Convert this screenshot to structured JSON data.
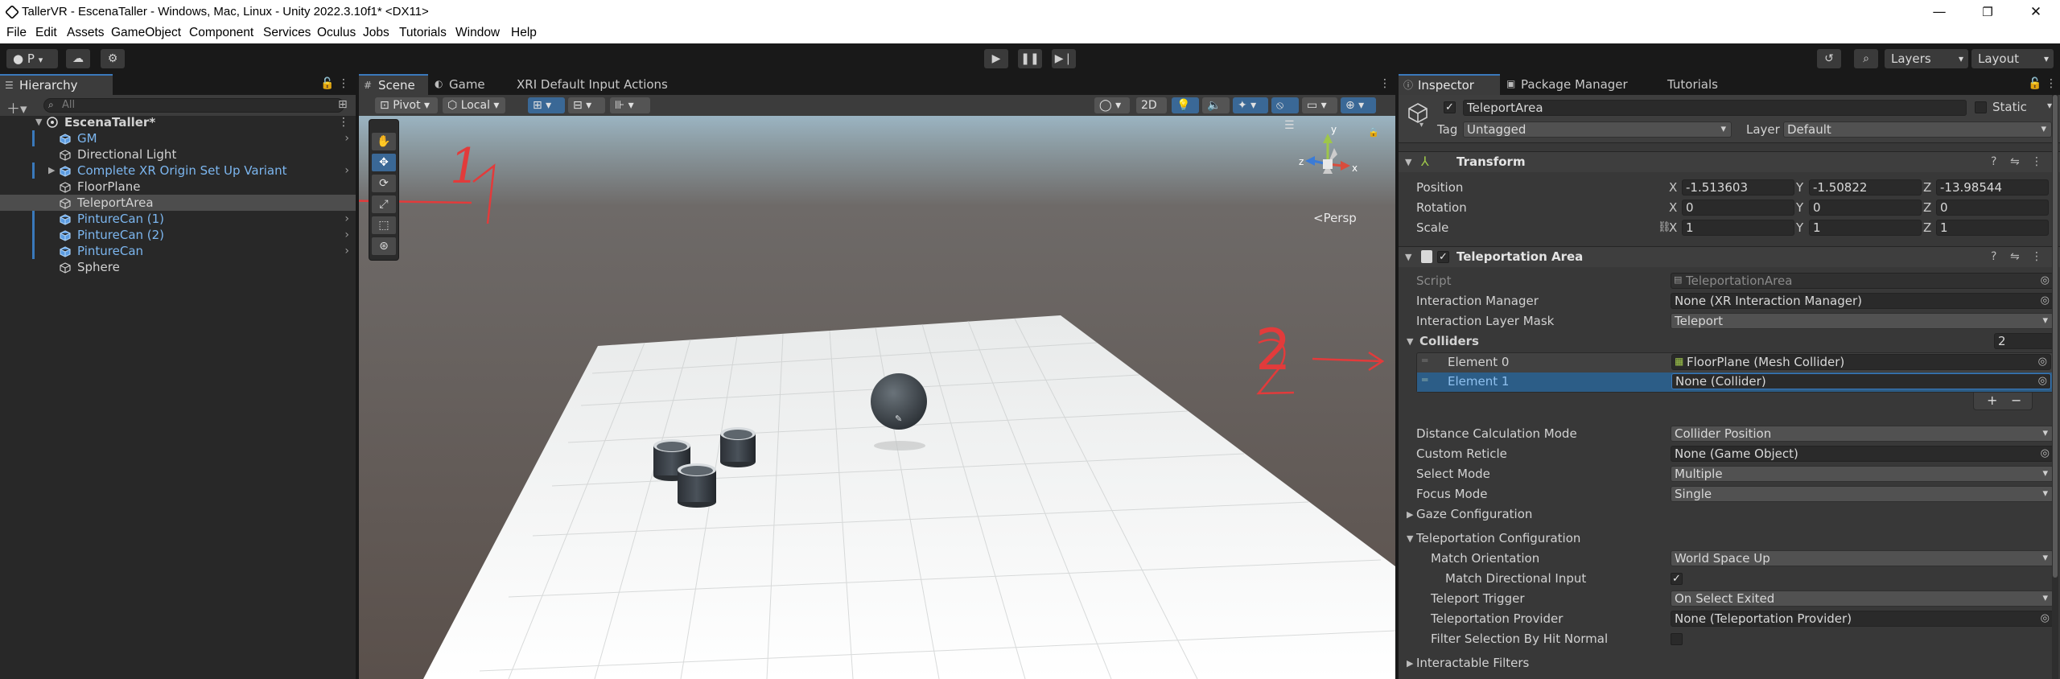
{
  "window": {
    "title": "TallerVR - EscenaTaller - Windows, Mac, Linux - Unity 2022.3.10f1* <DX11>",
    "minimize": "—",
    "restore": "❐",
    "close": "✕"
  },
  "menu": [
    "File",
    "Edit",
    "Assets",
    "GameObject",
    "Component",
    "Services",
    "Oculus",
    "Jobs",
    "Tutorials",
    "Window",
    "Help"
  ],
  "toolbar": {
    "account": "P",
    "layers": "Layers",
    "layout": "Layout"
  },
  "hierarchy": {
    "tab": "Hierarchy",
    "search_placeholder": "All",
    "scene_name": "EscenaTaller*",
    "items": [
      {
        "label": "GM",
        "prefab": true
      },
      {
        "label": "Directional Light",
        "prefab": false
      },
      {
        "label": "Complete XR Origin Set Up Variant",
        "prefab": true
      },
      {
        "label": "FloorPlane",
        "prefab": false
      },
      {
        "label": "TeleportArea",
        "prefab": false,
        "selected": true
      },
      {
        "label": "PintureCan (1)",
        "prefab": true
      },
      {
        "label": "PintureCan (2)",
        "prefab": true
      },
      {
        "label": "PintureCan",
        "prefab": true
      },
      {
        "label": "Sphere",
        "prefab": false
      }
    ]
  },
  "scene": {
    "tabs": [
      "Scene",
      "Game",
      "XRI Default Input Actions (..."
    ],
    "pivot": "Pivot",
    "local": "Local",
    "mode_2d": "2D",
    "persp": "<Persp",
    "gizmo_x": "x",
    "gizmo_y": "y",
    "gizmo_z": "z",
    "annotation_1": "1",
    "annotation_2": "2"
  },
  "inspector": {
    "tabs": [
      "Inspector",
      "Package Manager",
      "Tutorials"
    ],
    "object_name": "TeleportArea",
    "static_label": "Static",
    "tag_label": "Tag",
    "tag_value": "Untagged",
    "layer_label": "Layer",
    "layer_value": "Default",
    "transform": {
      "title": "Transform",
      "position_label": "Position",
      "rotation_label": "Rotation",
      "scale_label": "Scale",
      "position": {
        "x": "-1.513603",
        "y": "-1.50822",
        "z": "-13.98544"
      },
      "rotation": {
        "x": "0",
        "y": "0",
        "z": "0"
      },
      "scale": {
        "x": "1",
        "y": "1",
        "z": "1"
      },
      "axis_x": "X",
      "axis_y": "Y",
      "axis_z": "Z"
    },
    "teleportation_area": {
      "title": "Teleportation Area",
      "script_label": "Script",
      "script_value": "TeleportationArea",
      "interaction_manager_label": "Interaction Manager",
      "interaction_manager_value": "None (XR Interaction Manager)",
      "interaction_layer_mask_label": "Interaction Layer Mask",
      "interaction_layer_mask_value": "Teleport",
      "colliders_label": "Colliders",
      "colliders_count": "2",
      "element0_label": "Element 0",
      "element0_value": "FloorPlane (Mesh Collider)",
      "element1_label": "Element 1",
      "element1_value": "None (Collider)",
      "add": "+",
      "remove": "−",
      "distance_calc_label": "Distance Calculation Mode",
      "distance_calc_value": "Collider Position",
      "custom_reticle_label": "Custom Reticle",
      "custom_reticle_value": "None (Game Object)",
      "select_mode_label": "Select Mode",
      "select_mode_value": "Multiple",
      "focus_mode_label": "Focus Mode",
      "focus_mode_value": "Single",
      "gaze_config_label": "Gaze Configuration",
      "teleport_config_label": "Teleportation Configuration",
      "match_orientation_label": "Match Orientation",
      "match_orientation_value": "World Space Up",
      "match_directional_label": "Match Directional Input",
      "match_directional_checked": true,
      "teleport_trigger_label": "Teleport Trigger",
      "teleport_trigger_value": "On Select Exited",
      "teleport_provider_label": "Teleportation Provider",
      "teleport_provider_value": "None (Teleportation Provider)",
      "filter_selection_label": "Filter Selection By Hit Normal",
      "interactable_filters_label": "Interactable Filters"
    }
  },
  "colors": {
    "accent": "#3a79bb",
    "prefab_text": "#7cb6ef",
    "annotation_red": "#e23b3b",
    "panel_bg": "#383838"
  }
}
